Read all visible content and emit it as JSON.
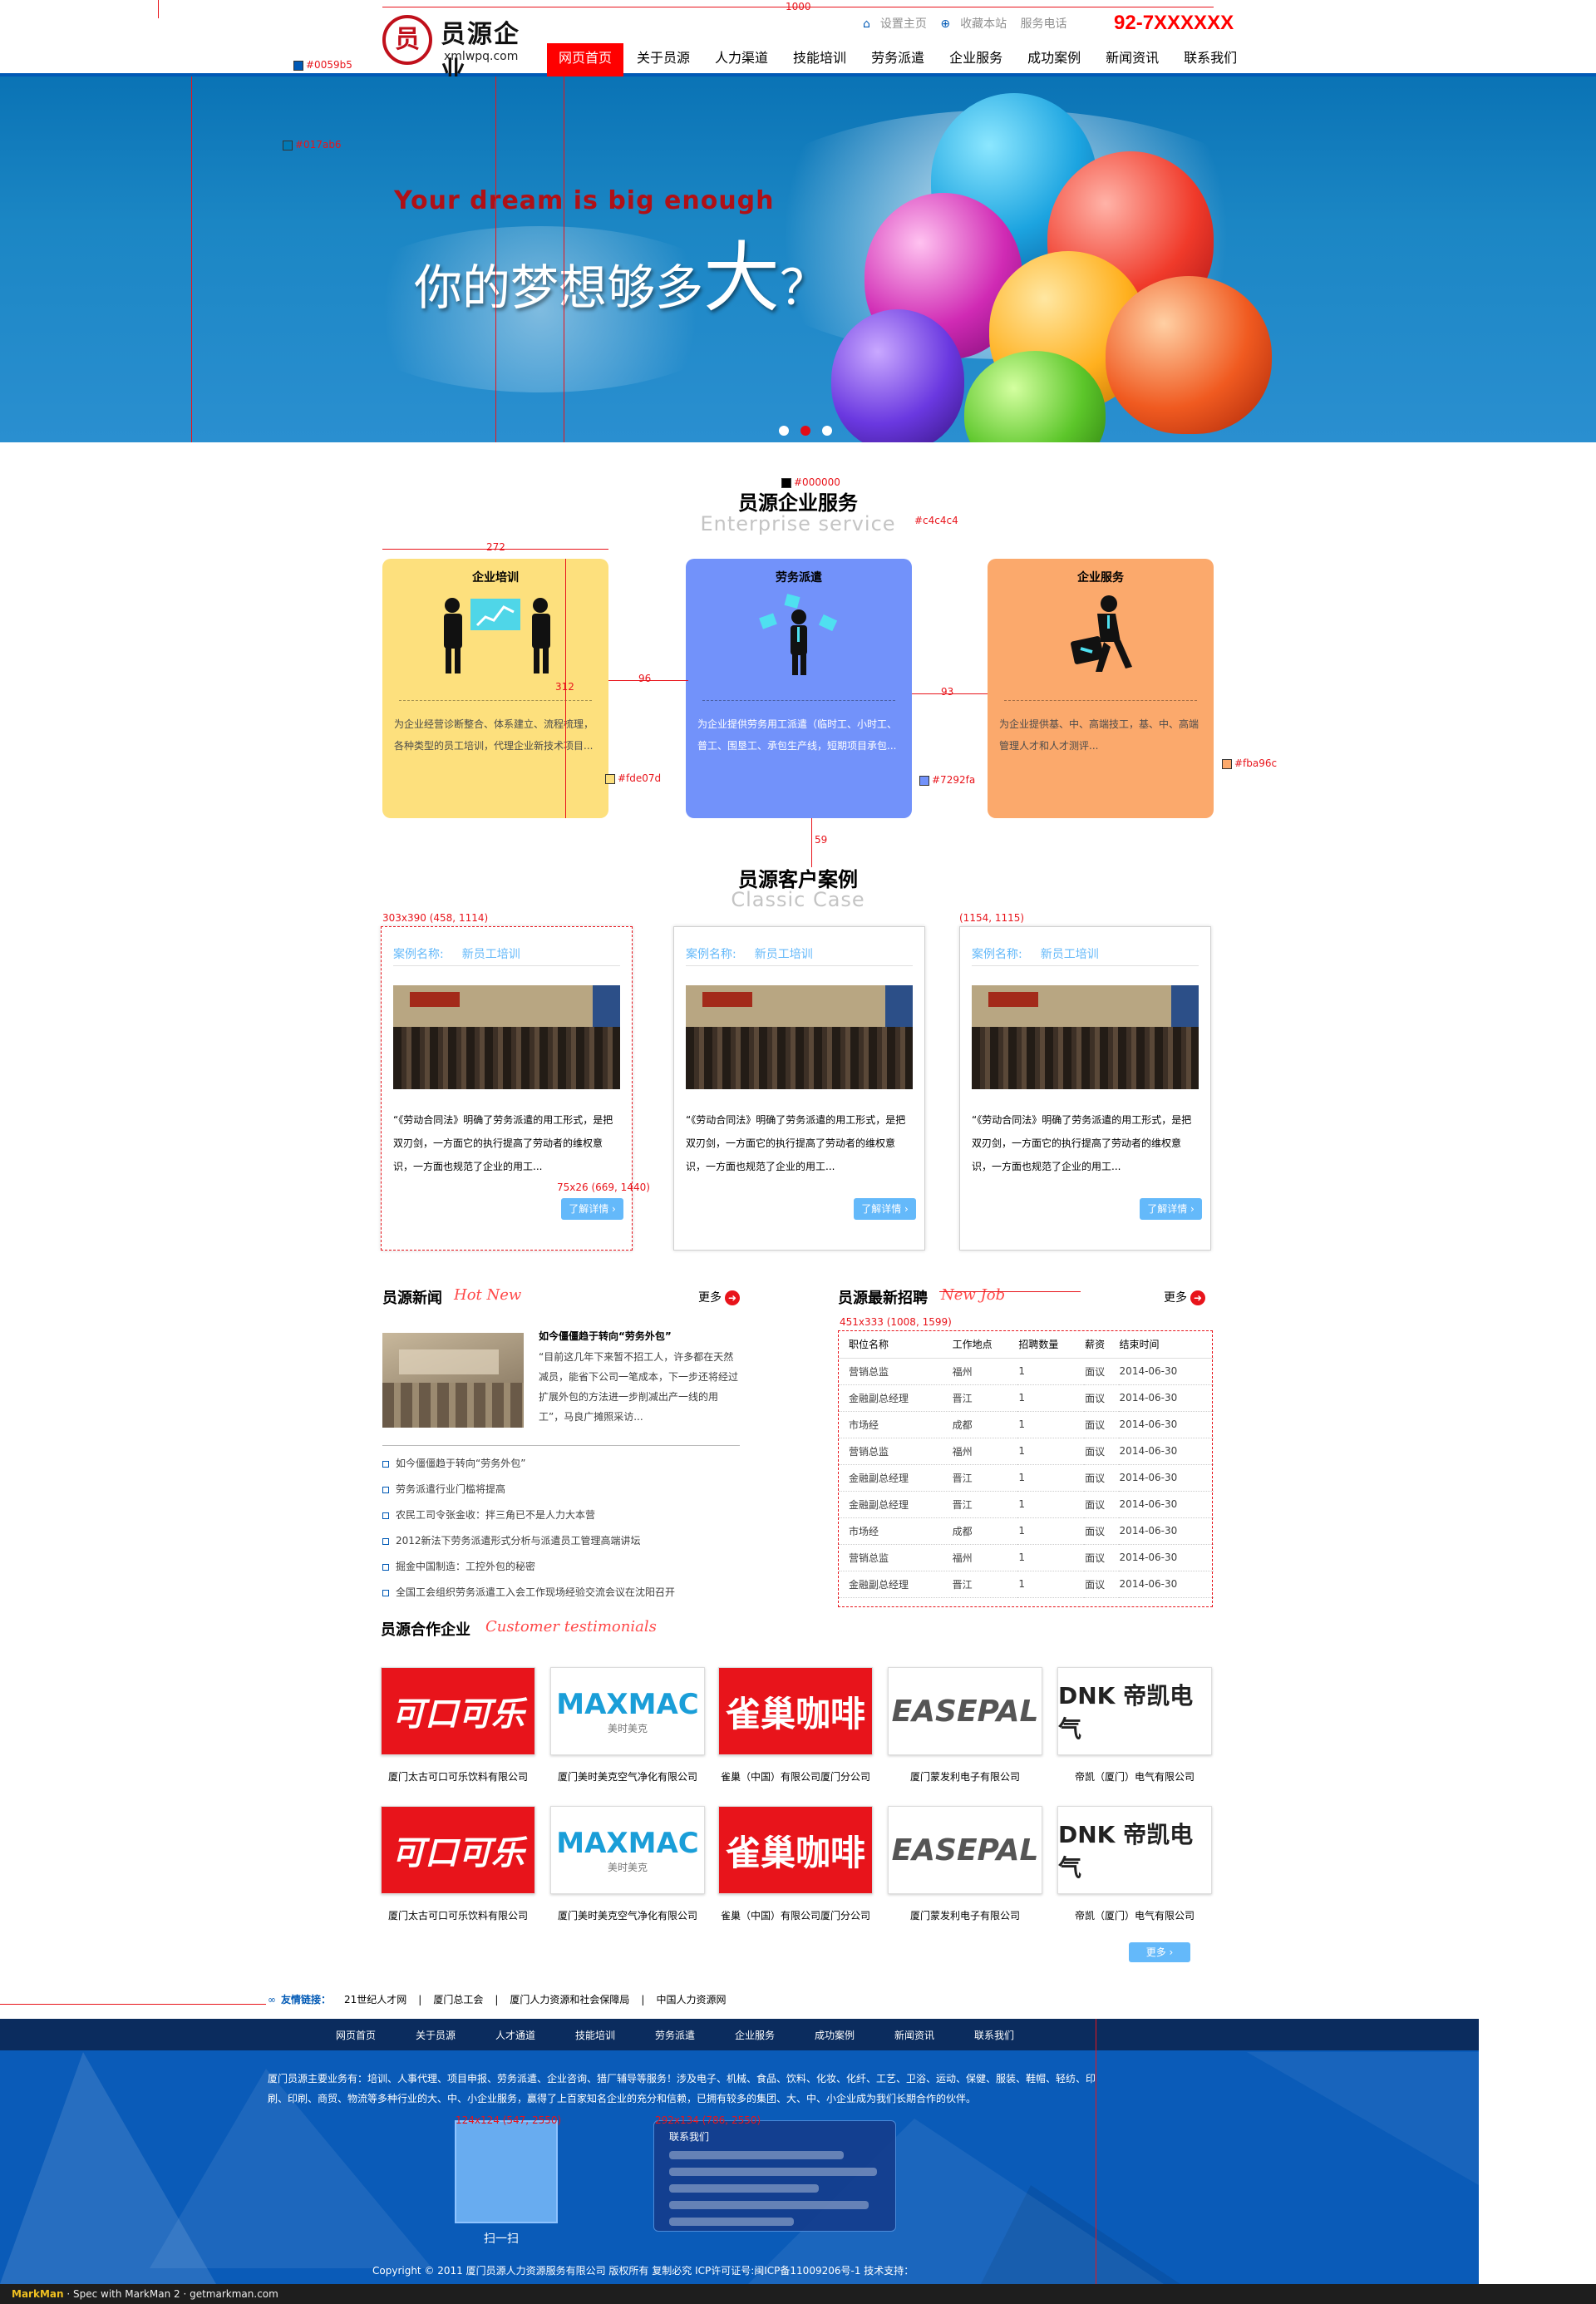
{
  "header": {
    "logo_cn": "员源企业",
    "logo_url": "xmlwpq.com",
    "top_links": [
      "设置主页",
      "收藏本站",
      "服务电话"
    ],
    "phone": "92-7XXXXXX",
    "nav": [
      "网页首页",
      "关于员源",
      "人力渠道",
      "技能培训",
      "劳务派遣",
      "企业服务",
      "成功案例",
      "新闻资讯",
      "联系我们"
    ],
    "active_nav": "网页首页"
  },
  "banner": {
    "en": "Your dream is big enough",
    "cn_prefix": "你的梦想够多",
    "cn_big": "大",
    "cn_suffix": "？",
    "dots": 3,
    "active_dot": 2
  },
  "services": {
    "title": "员源企业服务",
    "subtitle": "Enterprise service",
    "cards": [
      {
        "title": "企业培训",
        "desc": "为企业经营诊断整合、体系建立、流程梳理，各种类型的员工培训，代理企业新技术项目...",
        "color": "#fde07d",
        "icon": "training-icon"
      },
      {
        "title": "劳务派遣",
        "desc": "为企业提供劳务用工派遣（临时工、小时工、普工、围垦工、承包生产线，短期项目承包...",
        "color": "#7292fa",
        "icon": "dispatch-icon"
      },
      {
        "title": "企业服务",
        "desc": "为企业提供基、中、高端技工，基、中、高端管理人才和人才测评...",
        "color": "#fba96c",
        "icon": "service-icon"
      }
    ]
  },
  "cases": {
    "title": "员源客户案例",
    "subtitle": "Classic Case",
    "items": [
      {
        "label": "案例名称:",
        "name": "新员工培训",
        "desc": "“《劳动合同法》明确了劳务派遣的用工形式，是把双刃剑，一方面它的执行提高了劳动者的维权意识，一方面也规范了企业的用工...",
        "button": "了解详情 ›"
      },
      {
        "label": "案例名称:",
        "name": "新员工培训",
        "desc": "“《劳动合同法》明确了劳务派遣的用工形式，是把双刃剑，一方面它的执行提高了劳动者的维权意识，一方面也规范了企业的用工...",
        "button": "了解详情 ›"
      },
      {
        "label": "案例名称:",
        "name": "新员工培训",
        "desc": "“《劳动合同法》明确了劳务派遣的用工形式，是把双刃剑，一方面它的执行提高了劳动者的维权意识，一方面也规范了企业的用工...",
        "button": "了解详情 ›"
      }
    ]
  },
  "news": {
    "title": "员源新闻",
    "en": "Hot New",
    "more": "更多",
    "headline": "如今僵僵趋于转向“劳务外包”",
    "summary": "“目前这几年下来暂不招工人，许多都在天然减员，能省下公司一笔成本，下一步还将经过扩展外包的方法进一步削减出产一线的用工”，马良广摊照采访...",
    "list": [
      "如今僵僵趋于转向“劳务外包”",
      "劳务派遣行业门槛将提高",
      "农民工司令张金收：拌三角已不是人力大本营",
      "2012新法下劳务派遣形式分析与派遣员工管理高端讲坛",
      "掘金中国制造：工控外包的秘密",
      "全国工会组织劳务派遣工入会工作现场经验交流会议在沈阳召开"
    ]
  },
  "jobs": {
    "title": "员源最新招聘",
    "en": "New Job",
    "more": "更多",
    "headers": [
      "职位名称",
      "工作地点",
      "招聘数量",
      "薪资",
      "结束时间"
    ],
    "rows": [
      [
        "营销总监",
        "福州",
        "1",
        "面议",
        "2014-06-30"
      ],
      [
        "金融副总经理",
        "晋江",
        "1",
        "面议",
        "2014-06-30"
      ],
      [
        "市场经",
        "成都",
        "1",
        "面议",
        "2014-06-30"
      ],
      [
        "营销总监",
        "福州",
        "1",
        "面议",
        "2014-06-30"
      ],
      [
        "金融副总经理",
        "晋江",
        "1",
        "面议",
        "2014-06-30"
      ],
      [
        "金融副总经理",
        "晋江",
        "1",
        "面议",
        "2014-06-30"
      ],
      [
        "市场经",
        "成都",
        "1",
        "面议",
        "2014-06-30"
      ],
      [
        "营销总监",
        "福州",
        "1",
        "面议",
        "2014-06-30"
      ],
      [
        "金融副总经理",
        "晋江",
        "1",
        "面议",
        "2014-06-30"
      ]
    ]
  },
  "partners": {
    "title": "员源合作企业",
    "en": "Customer testimonials",
    "more": "更多 ›",
    "logos": [
      {
        "brand": "可口可乐",
        "caption": "厦门太古可口可乐饮料有限公司"
      },
      {
        "brand": "MAXMAC",
        "sub": "美时美克",
        "caption": "厦门美时美克空气净化有限公司"
      },
      {
        "brand": "雀巢咖啡",
        "caption": "雀巢（中国）有限公司厦门分公司"
      },
      {
        "brand": "EASEPAL",
        "caption": "厦门蒙发利电子有限公司"
      },
      {
        "brand": "DNK 帝凯电气",
        "caption": "帝凯（厦门）电气有限公司"
      }
    ]
  },
  "friends": {
    "label": "友情链接：",
    "links": [
      "21世纪人才网",
      "厦门总工会",
      "厦门人力资源和社会保障局",
      "中国人力资源网"
    ]
  },
  "footer": {
    "nav": [
      "网页首页",
      "关于员源",
      "人才通道",
      "技能培训",
      "劳务派遣",
      "企业服务",
      "成功案例",
      "新闻资讯",
      "联系我们"
    ],
    "desc": "厦门员源主要业务有：培训、人事代理、项目申报、劳务派遣、企业咨询、猎厂辅导等服务！涉及电子、机械、食品、饮料、化妆、化纤、工艺、卫浴、运动、保健、服装、鞋帽、轻纺、印刷、印刷、商贸、物流等多种行业的大、中、小企业服务，赢得了上百家知名企业的充分和信赖，已拥有较多的集团、大、中、小企业成为我们长期合作的伙伴。",
    "qr_caption": "扫一扫",
    "contact_title": "联系我们",
    "copyright": "Copyright © 2011 厦门员源人力资源服务有限公司  版权所有  复制必究  ICP许可证号:闽ICP备11009206号-1  技术支持："
  },
  "annotations": {
    "colors": {
      "brand_blue": "#0059b5",
      "red": "#ff0000",
      "yellow_card": "#fde07d",
      "blue_card": "#7292fa",
      "orange_card": "#fba96c",
      "link_blue": "#64b9fa",
      "text": "#3e3e3e",
      "grey_sub": "#c4c4c4"
    },
    "labels": [
      "#0059b5",
      "#017ab6",
      "#000000",
      "#c4c4c4",
      "#fde07d",
      "#7292fa",
      "#fba96c",
      "#64b9fa",
      "#ff4a4a",
      "#3e3e3e",
      "#ff0000",
      "#909090",
      "#4c4c4c",
      "微软雅黑",
      "宋体",
      "Adobe 黑体 Std",
      "arial",
      "Regular",
      "1000",
      "272",
      "312",
      "96",
      "93",
      "59",
      "303x390 (458, 1114)",
      "(1154, 1115)",
      "75x26 (669, 1440)",
      "451x333 (1008, 1599)",
      "124x124 (547, 2550)",
      "292x134 (786, 2550)"
    ]
  },
  "markman": {
    "brand": "MarkMan",
    "text": "Spec with MarkMan 2",
    "site": "getmarkman.com"
  }
}
